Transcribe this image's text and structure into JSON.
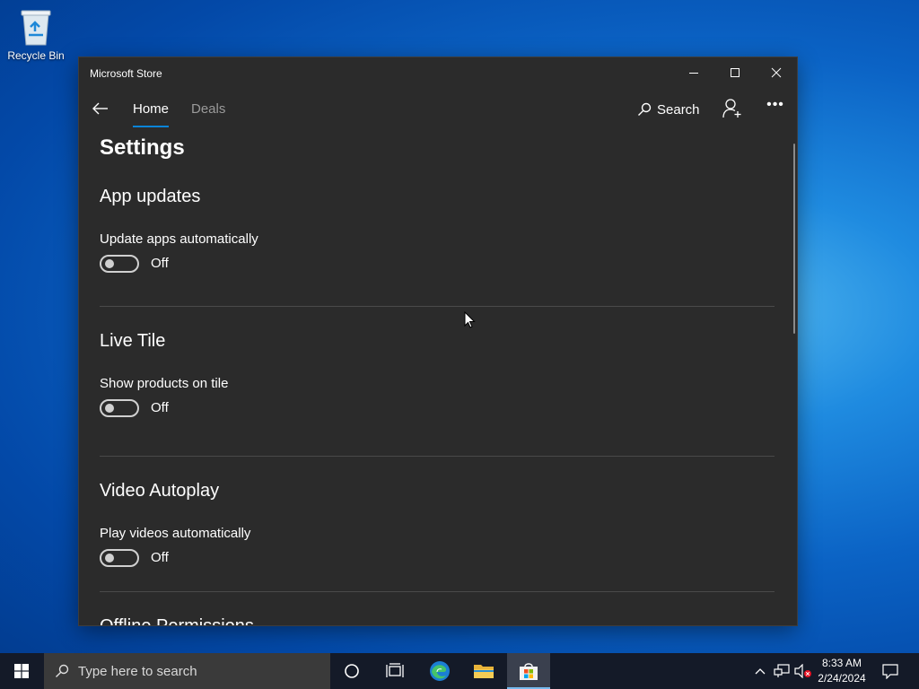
{
  "desktop": {
    "recycle_bin_label": "Recycle Bin"
  },
  "window": {
    "title": "Microsoft Store",
    "nav": {
      "tabs": [
        {
          "label": "Home",
          "active": true
        },
        {
          "label": "Deals",
          "active": false
        }
      ],
      "search_label": "Search"
    },
    "page_title": "Settings",
    "sections": [
      {
        "title": "App updates",
        "setting_label": "Update apps automatically",
        "toggle_state": "Off"
      },
      {
        "title": "Live Tile",
        "setting_label": "Show products on tile",
        "toggle_state": "Off"
      },
      {
        "title": "Video Autoplay",
        "setting_label": "Play videos automatically",
        "toggle_state": "Off"
      },
      {
        "title": "Offline Permissions"
      }
    ]
  },
  "taskbar": {
    "search_placeholder": "Type here to search",
    "clock_time": "8:33 AM",
    "clock_date": "2/24/2024"
  },
  "colors": {
    "accent": "#0a84d8",
    "window_bg": "#2b2b2b",
    "taskbar_bg": "#141a28"
  }
}
